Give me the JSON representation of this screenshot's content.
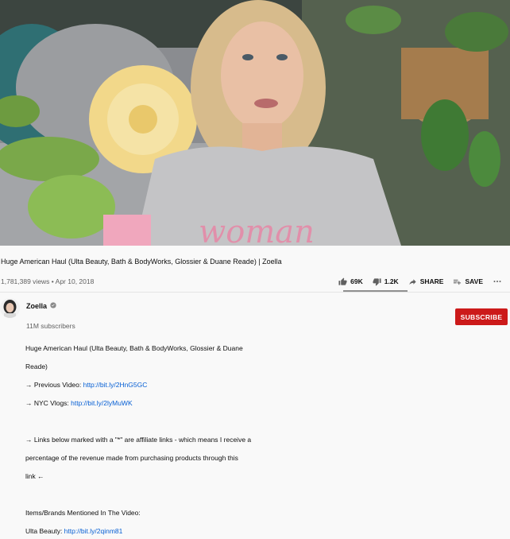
{
  "video": {
    "title": "Huge American Haul (Ulta Beauty, Bath & BodyWorks, Glossier & Duane Reade) | Zoella",
    "views_date": "1,781,389 views • Apr 10, 2018",
    "likes": "69K",
    "dislikes": "1.2K",
    "share_label": "SHARE",
    "save_label": "SAVE",
    "more_icon": "more-horizontal-icon"
  },
  "channel": {
    "name": "Zoella",
    "subscribers": "11M subscribers",
    "subscribe_label": "SUBSCRIBE"
  },
  "description": {
    "line1": "Huge American Haul (Ulta Beauty, Bath & BodyWorks, Glossier & Duane",
    "line2": "Reade)",
    "prev_prefix": "→ Previous Video: ",
    "prev_link": "http://bit.ly/2HnG5GC",
    "nyc_prefix": "→ NYC Vlogs: ",
    "nyc_link": "http://bit.ly/2lyMuWK",
    "aff1": "→ Links below marked with a \"*\" are affiliate links - which means I receive a",
    "aff2": "percentage of the revenue made from purchasing products through this",
    "aff3": "link ←",
    "items_heading": "Items/Brands Mentioned In The Video:",
    "ulta_prefix": "Ulta Beauty: ",
    "ulta_link": "http://bit.ly/2qinm81"
  },
  "colors": {
    "subscribe": "#cc1a1a",
    "link": "#065fd4",
    "secondary_text": "#606060"
  }
}
